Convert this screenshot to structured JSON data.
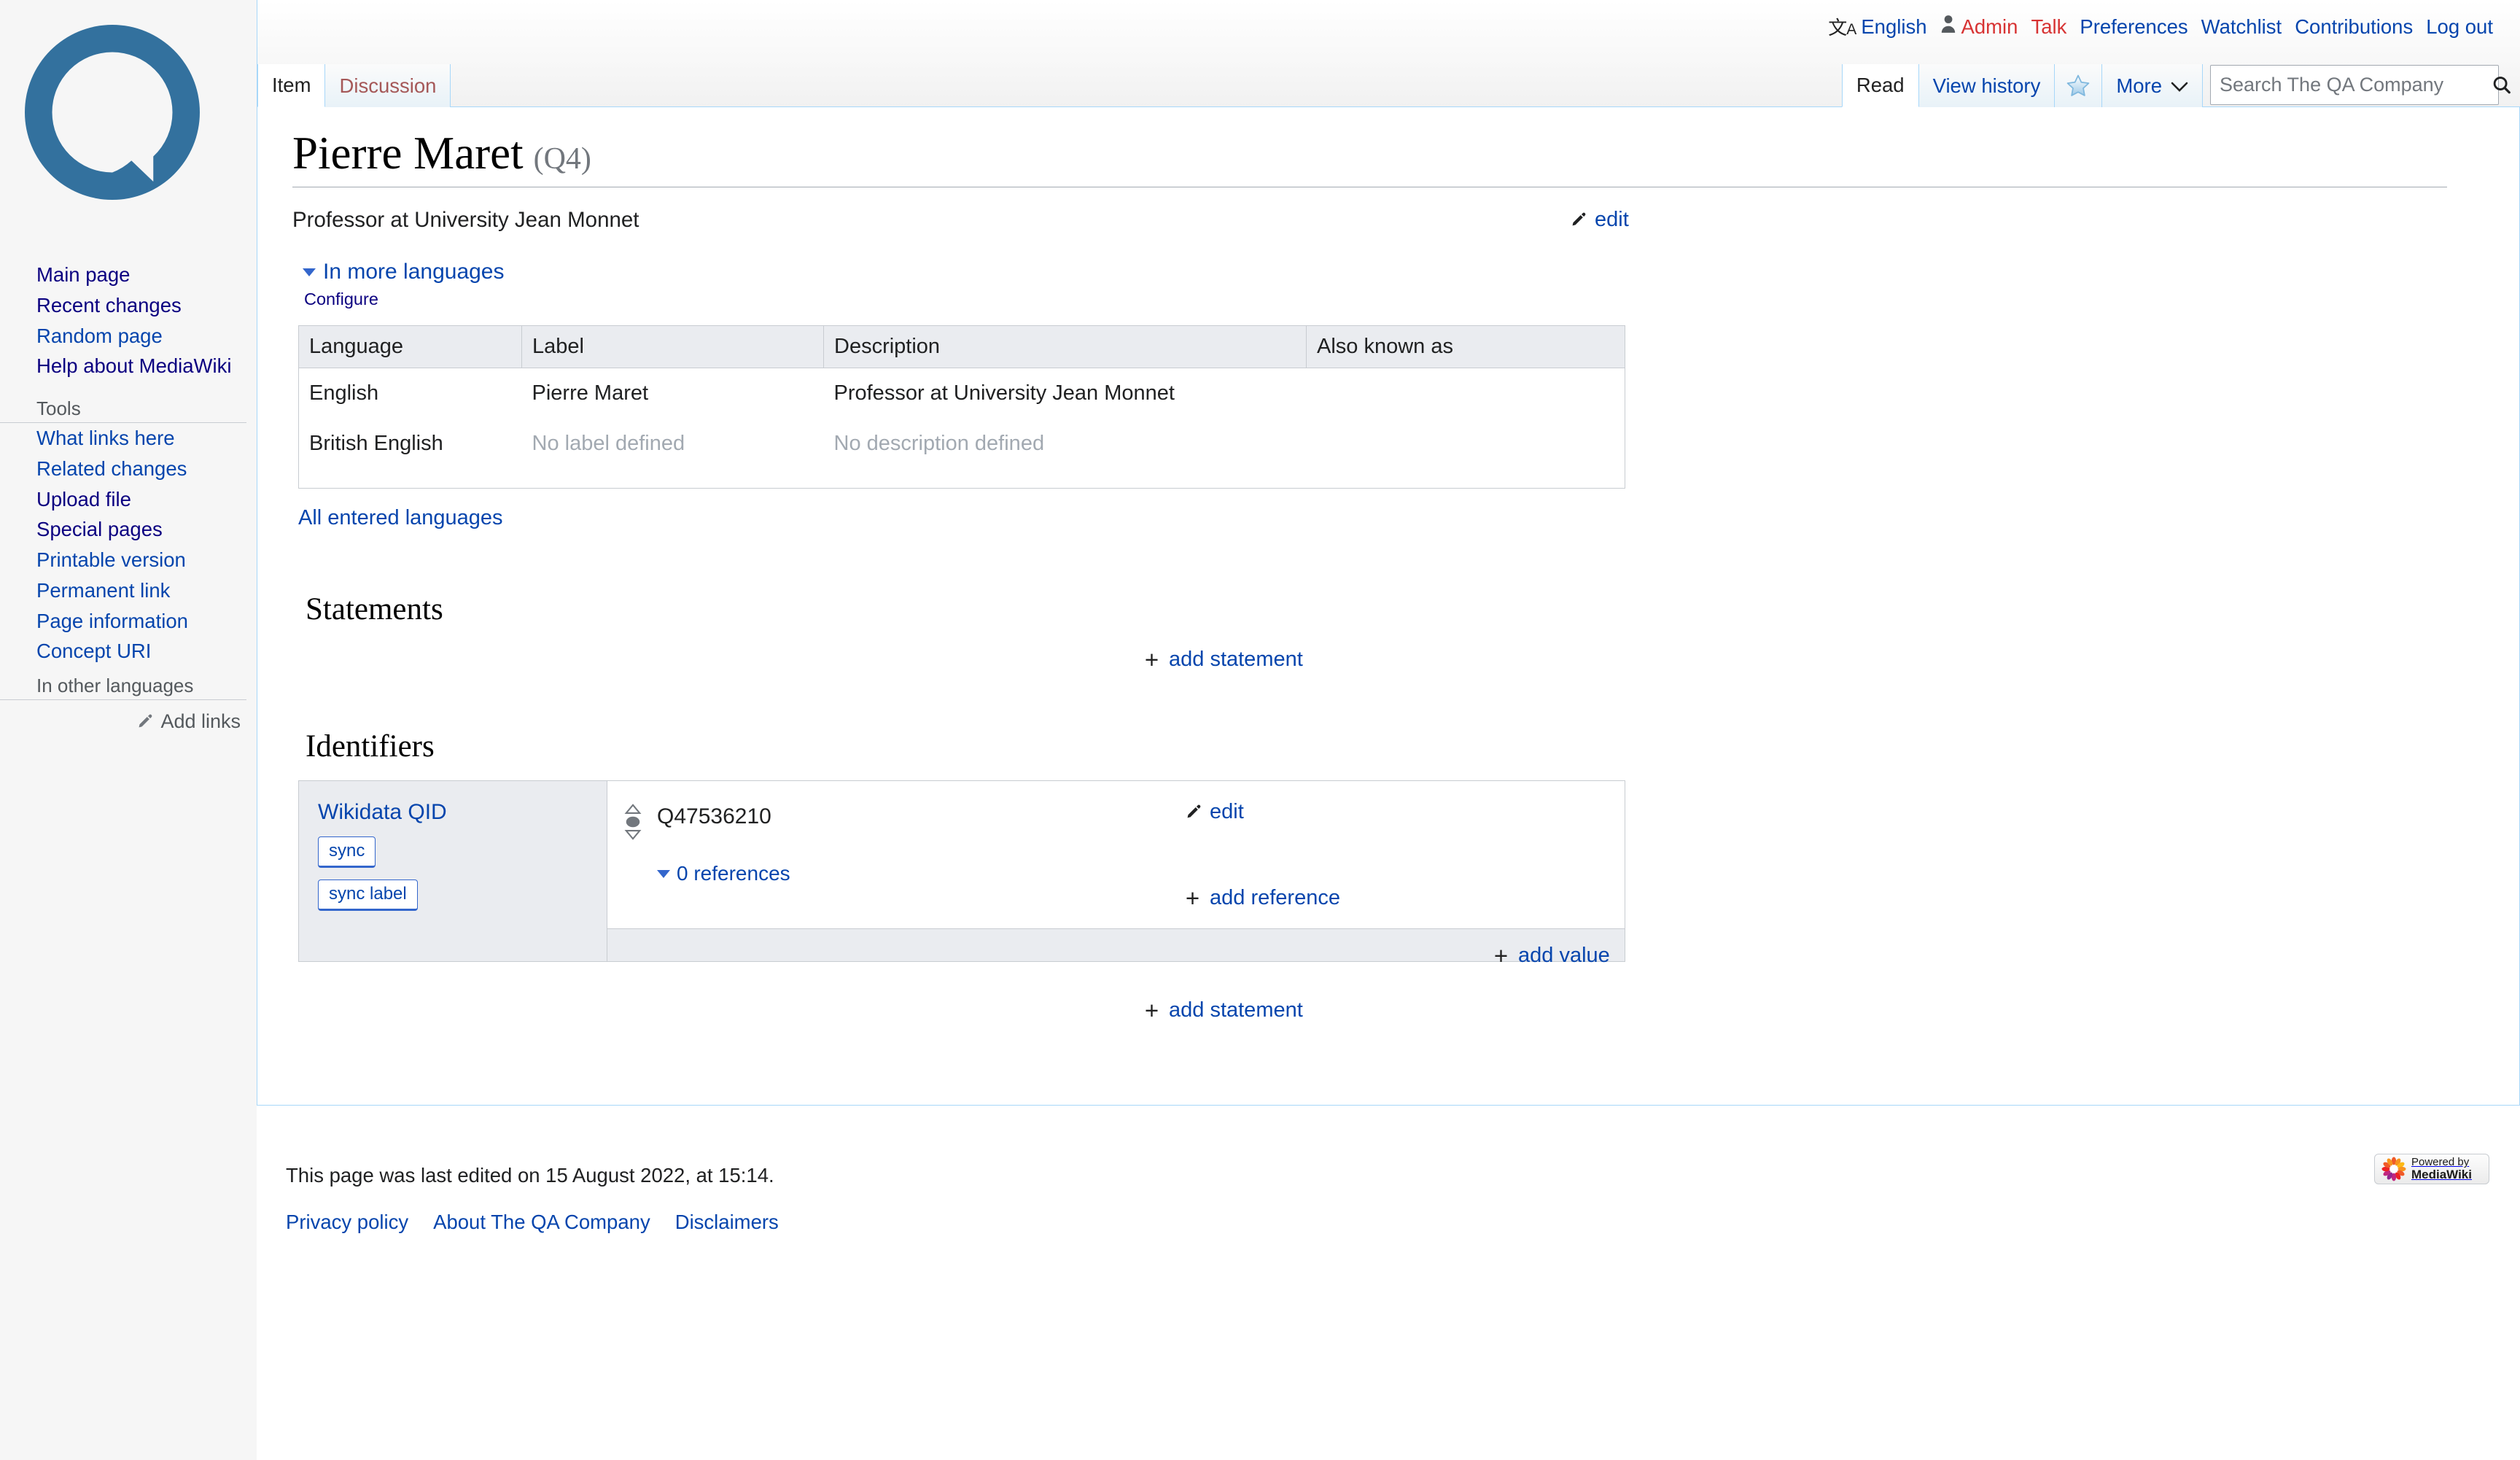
{
  "site": {
    "logo_name": "qa-company-logo",
    "search_placeholder": "Search The QA Company",
    "search_value": ""
  },
  "personal_tools": [
    {
      "name": "uls-language",
      "label": "English",
      "icon": "language-icon",
      "style": "link"
    },
    {
      "name": "userpage",
      "label": "Admin",
      "icon": "user-icon",
      "style": "new"
    },
    {
      "name": "mytalk",
      "label": "Talk",
      "style": "new"
    },
    {
      "name": "preferences",
      "label": "Preferences",
      "style": "link"
    },
    {
      "name": "watchlist",
      "label": "Watchlist",
      "style": "link"
    },
    {
      "name": "mycontris",
      "label": "Contributions",
      "style": "link"
    },
    {
      "name": "logout",
      "label": "Log out",
      "style": "link"
    }
  ],
  "namespace_tabs": [
    {
      "name": "item",
      "label": "Item",
      "selected": true,
      "new": false
    },
    {
      "name": "discussion",
      "label": "Discussion",
      "selected": false,
      "new": true
    }
  ],
  "view_tabs": [
    {
      "name": "read",
      "label": "Read",
      "selected": true
    },
    {
      "name": "view-history",
      "label": "View history",
      "selected": false
    }
  ],
  "watch_tab": {
    "name": "watch-star",
    "icon": "star-icon",
    "label": ""
  },
  "more_tab": {
    "name": "more-menu",
    "label": "More",
    "icon": "chevron-down-icon"
  },
  "sidebar": {
    "navigation": [
      {
        "label": "Main page"
      },
      {
        "label": "Recent changes"
      },
      {
        "label": "Random page"
      },
      {
        "label": "Help about MediaWiki"
      }
    ],
    "tools_heading": "Tools",
    "tools": [
      {
        "label": "What links here"
      },
      {
        "label": "Related changes"
      },
      {
        "label": "Upload file"
      },
      {
        "label": "Special pages"
      },
      {
        "label": "Printable version"
      },
      {
        "label": "Permanent link"
      },
      {
        "label": "Page information"
      },
      {
        "label": "Concept URI"
      }
    ],
    "languages_heading": "In other languages",
    "add_links_label": "Add links"
  },
  "page": {
    "title": "Pierre Maret",
    "entity_id": "(Q4)",
    "description": "Professor at University Jean Monnet",
    "edit_label": "edit"
  },
  "in_more_languages": {
    "toggle_label": "In more languages",
    "configure_label": "Configure",
    "columns": [
      "Language",
      "Label",
      "Description",
      "Also known as"
    ],
    "rows": [
      {
        "language": "English",
        "label": "Pierre Maret",
        "description": "Professor at University Jean Monnet",
        "aliases": "",
        "label_empty": false,
        "description_empty": false
      },
      {
        "language": "British English",
        "label": "No label defined",
        "description": "No description defined",
        "aliases": "",
        "label_empty": true,
        "description_empty": true
      }
    ],
    "all_entered_languages_label": "All entered languages"
  },
  "statements": {
    "heading": "Statements",
    "add_statement_label": "add statement"
  },
  "identifiers": {
    "heading": "Identifiers",
    "add_statement_label": "add statement",
    "groups": [
      {
        "property_label": "Wikidata QID",
        "buttons": [
          {
            "name": "sync-button",
            "label": "sync"
          },
          {
            "name": "sync-label-button",
            "label": "sync label"
          }
        ],
        "claims": [
          {
            "rank": "normal",
            "value": "Q47536210",
            "edit_label": "edit",
            "references_label": "0 references",
            "add_reference_label": "add reference"
          }
        ],
        "add_value_label": "add value"
      }
    ]
  },
  "footer": {
    "last_edited": "This page was last edited on 15 August 2022, at 15:14.",
    "places": [
      "Privacy policy",
      "About The QA Company",
      "Disclaimers"
    ],
    "badge": {
      "line1": "Powered by",
      "line2": "MediaWiki"
    }
  },
  "colors": {
    "link": "#0645ad",
    "link_visited": "#0b0080",
    "link_new": "#d73333",
    "tab_border": "#a7d7f9",
    "logo_blue": "#33719e",
    "panel_bg": "#f6f6f6",
    "table_header_bg": "#eaecf0"
  }
}
